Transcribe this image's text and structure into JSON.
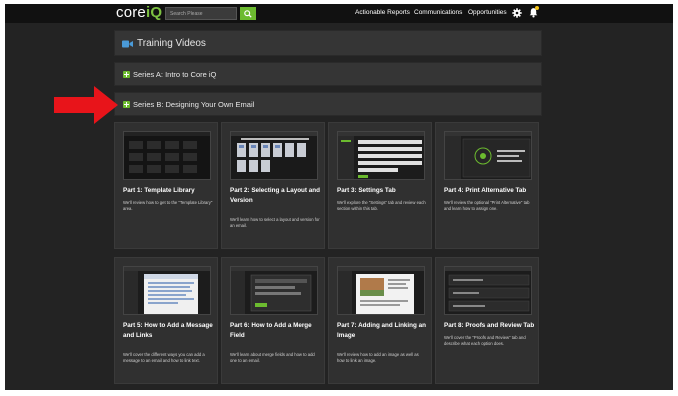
{
  "header": {
    "logo_main": "core",
    "logo_accent": "iQ",
    "search_placeholder": "Search Please",
    "nav": [
      "Actionable Reports",
      "Communications",
      "Opportunities"
    ],
    "accent_color": "#6cbb2f"
  },
  "training": {
    "title": "Training Videos",
    "series": [
      {
        "label": "Series A: Intro to Core iQ"
      },
      {
        "label": "Series B: Designing Your Own Email"
      }
    ]
  },
  "cards": [
    {
      "title": "Part 1: Template Library",
      "desc": "We'll review how to get to the \"Template Library\" area."
    },
    {
      "title": "Part 2: Selecting a Layout and Version",
      "desc": "We'll learn how to select a layout and version for an email."
    },
    {
      "title": "Part 3: Settings Tab",
      "desc": "We'll explore the \"Settings\" tab and review each section within this tab."
    },
    {
      "title": "Part 4: Print Alternative Tab",
      "desc": "We'll review the optional \"Print Alternative\" tab and learn how to assign one."
    },
    {
      "title": "Part 5: How to Add a Message and Links",
      "desc": "We'll cover the different ways you can add a message to an email and how to link text."
    },
    {
      "title": "Part 6: How to Add a Merge Field",
      "desc": "We'll learn about merge fields and how to add one to an email."
    },
    {
      "title": "Part 7: Adding and Linking an Image",
      "desc": "We'll review how to add an image as well as how to link an image."
    },
    {
      "title": "Part 8: Proofs and Review Tab",
      "desc": "We'll cover the \"Proofs and Review\" tab and describe what each option does."
    }
  ]
}
